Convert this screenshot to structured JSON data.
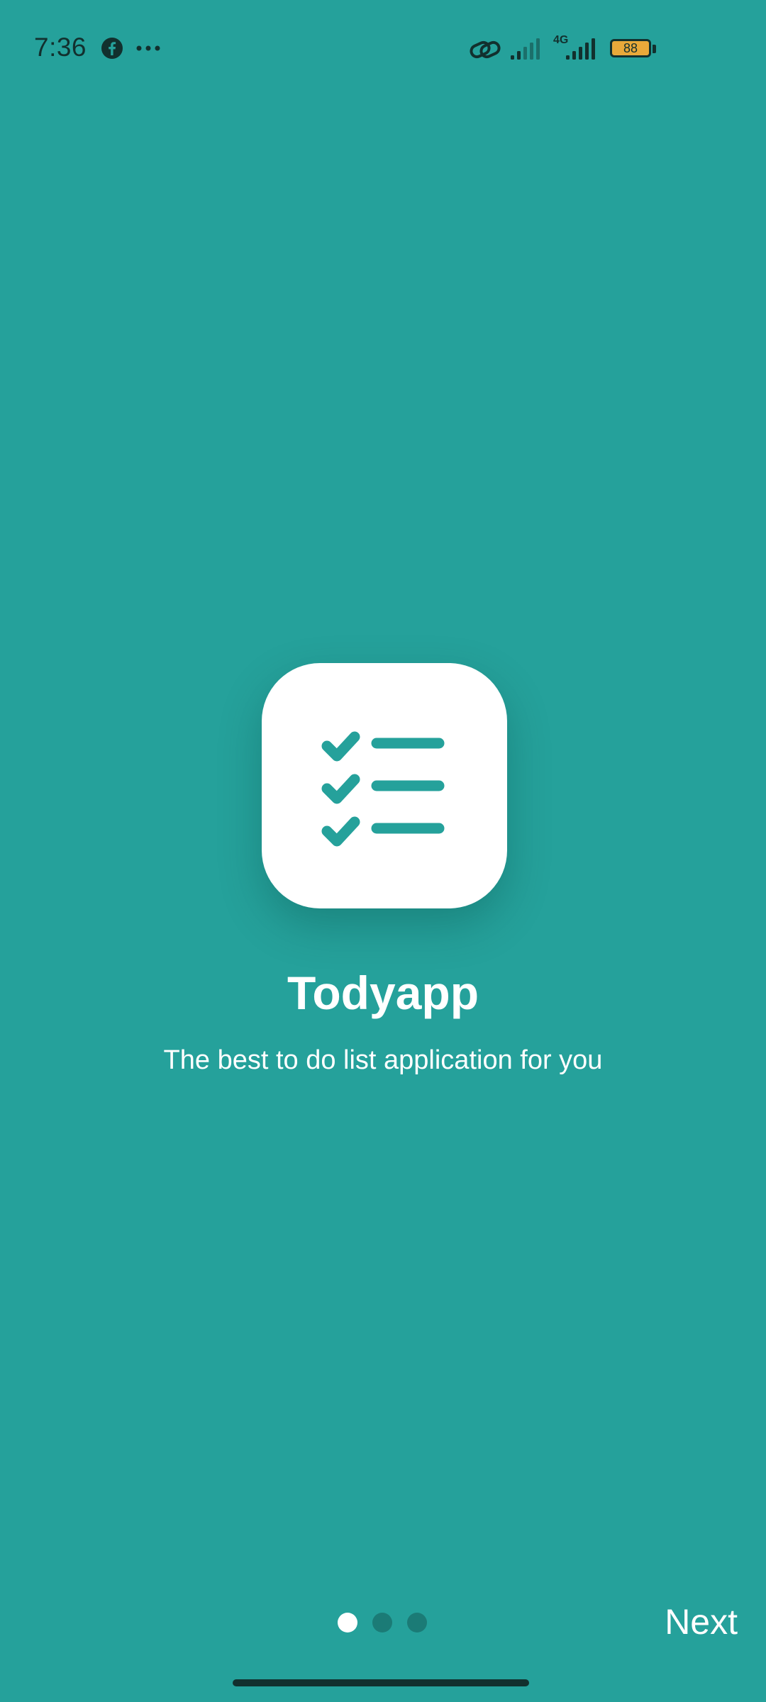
{
  "status_bar": {
    "time": "7:36",
    "network_label": "4G",
    "battery_level": "88",
    "icons": [
      "facebook-icon",
      "more-icon",
      "link-icon",
      "signal-icon",
      "signal-icon",
      "battery-icon"
    ]
  },
  "onboarding": {
    "icon": "checklist-icon",
    "title": "Todyapp",
    "subtitle": "The best to do list application for you",
    "page_indicator": {
      "total": 3,
      "active_index": 0
    },
    "next_label": "Next"
  },
  "colors": {
    "background": "#25A19B",
    "accent": "#25A19B",
    "dot_inactive": "#1B7B76",
    "battery_fill": "#E8A93A"
  }
}
